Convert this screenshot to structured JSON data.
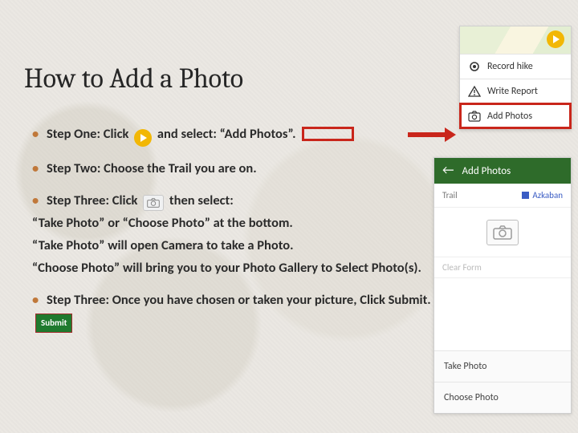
{
  "title": "How to Add a Photo",
  "steps": {
    "one_a": "Step One: Click",
    "one_b": "and select: “Add Photos”.",
    "two": "Step Two: Choose the Trail you are on.",
    "three_a": "Step Three: Click",
    "three_b": "then select:",
    "three_l1": "“Take Photo” or “Choose Photo” at the bottom.",
    "three_l2": "“Take Photo” will open Camera to take a Photo.",
    "three_l3": "“Choose Photo” will bring you to your Photo Gallery to Select Photo(s).",
    "four": "Step Three: Once you have chosen or taken your picture,  Click Submit."
  },
  "submit_label": "Submit",
  "menu": {
    "record": "Record hike",
    "write": "Write Report",
    "add": "Add Photos"
  },
  "addPhotos": {
    "header": "Add Photos",
    "trail_label": "Trail",
    "trail_value": "Azkaban",
    "clear": "Clear Form",
    "take": "Take Photo",
    "choose": "Choose Photo"
  },
  "colors": {
    "accent_red": "#c9261b",
    "accent_green": "#2e6b2a",
    "play_yellow": "#f2b705"
  }
}
